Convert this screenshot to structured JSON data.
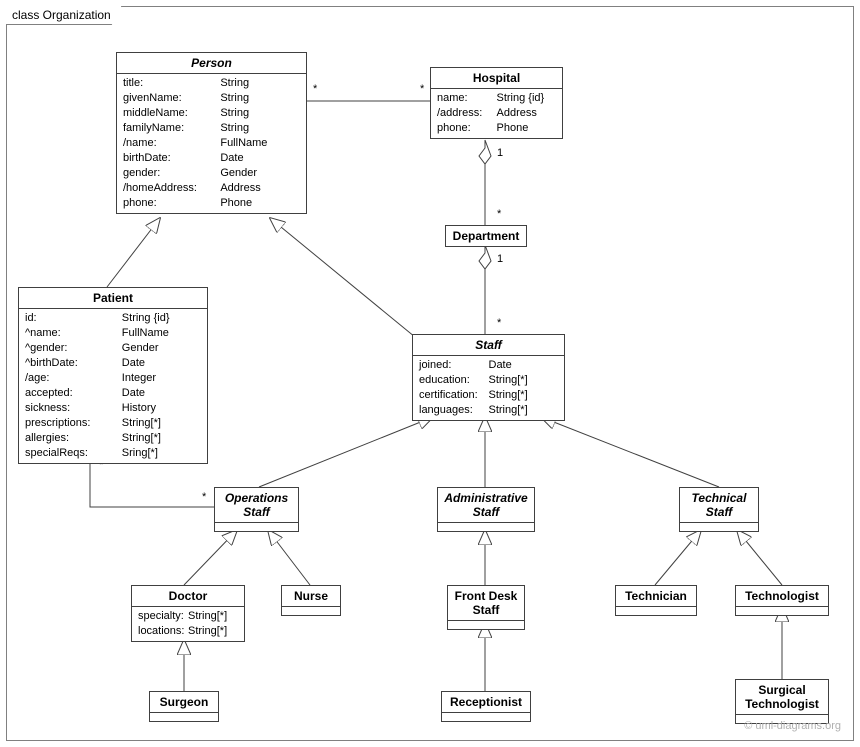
{
  "packageName": "class Organization",
  "classes": {
    "person": {
      "name": "Person",
      "abstract": true,
      "attrs": [
        {
          "n": "title:",
          "t": "String"
        },
        {
          "n": "givenName:",
          "t": "String"
        },
        {
          "n": "middleName:",
          "t": "String"
        },
        {
          "n": "familyName:",
          "t": "String"
        },
        {
          "n": "/name:",
          "t": "FullName"
        },
        {
          "n": "birthDate:",
          "t": "Date"
        },
        {
          "n": "gender:",
          "t": "Gender"
        },
        {
          "n": "/homeAddress:",
          "t": "Address"
        },
        {
          "n": "phone:",
          "t": "Phone"
        }
      ]
    },
    "hospital": {
      "name": "Hospital",
      "abstract": false,
      "attrs": [
        {
          "n": "name:",
          "t": "String {id}"
        },
        {
          "n": "/address:",
          "t": "Address"
        },
        {
          "n": "phone:",
          "t": "Phone"
        }
      ]
    },
    "department": {
      "name": "Department",
      "abstract": false,
      "attrs": []
    },
    "patient": {
      "name": "Patient",
      "abstract": false,
      "attrs": [
        {
          "n": "id:",
          "t": "String {id}"
        },
        {
          "n": "^name:",
          "t": "FullName"
        },
        {
          "n": "^gender:",
          "t": "Gender"
        },
        {
          "n": "^birthDate:",
          "t": "Date"
        },
        {
          "n": "/age:",
          "t": "Integer"
        },
        {
          "n": "accepted:",
          "t": "Date"
        },
        {
          "n": "sickness:",
          "t": "History"
        },
        {
          "n": "prescriptions:",
          "t": "String[*]"
        },
        {
          "n": "allergies:",
          "t": "String[*]"
        },
        {
          "n": "specialReqs:",
          "t": "Sring[*]"
        }
      ]
    },
    "staff": {
      "name": "Staff",
      "abstract": true,
      "attrs": [
        {
          "n": "joined:",
          "t": "Date"
        },
        {
          "n": "education:",
          "t": "String[*]"
        },
        {
          "n": "certification:",
          "t": "String[*]"
        },
        {
          "n": "languages:",
          "t": "String[*]"
        }
      ]
    },
    "opsStaff": {
      "name": "OperationsStaff",
      "display": "Operations\nStaff",
      "abstract": true
    },
    "adminStaff": {
      "name": "AdministrativeStaff",
      "display": "Administrative\nStaff",
      "abstract": true
    },
    "techStaff": {
      "name": "TechnicalStaff",
      "display": "Technical\nStaff",
      "abstract": true
    },
    "doctor": {
      "name": "Doctor",
      "abstract": false,
      "attrs": [
        {
          "n": "specialty:",
          "t": "String[*]"
        },
        {
          "n": "locations:",
          "t": "String[*]"
        }
      ]
    },
    "nurse": {
      "name": "Nurse",
      "abstract": false
    },
    "frontDesk": {
      "name": "FrontDeskStaff",
      "display": "Front Desk\nStaff",
      "abstract": false
    },
    "technician": {
      "name": "Technician",
      "abstract": false
    },
    "technologist": {
      "name": "Technologist",
      "abstract": false
    },
    "surgeon": {
      "name": "Surgeon",
      "abstract": false
    },
    "receptionist": {
      "name": "Receptionist",
      "abstract": false
    },
    "surgTech": {
      "name": "SurgicalTechnologist",
      "display": "Surgical\nTechnologist",
      "abstract": false
    }
  },
  "mults": {
    "personHospitalLeft": "*",
    "personHospitalRight": "*",
    "hospitalDeptTop": "1",
    "hospitalDeptBottom": "*",
    "deptStaffTop": "1",
    "deptStaffBottom": "*",
    "patientOpsLeft": "*",
    "patientOpsRight": "*"
  },
  "watermark": "© uml-diagrams.org"
}
